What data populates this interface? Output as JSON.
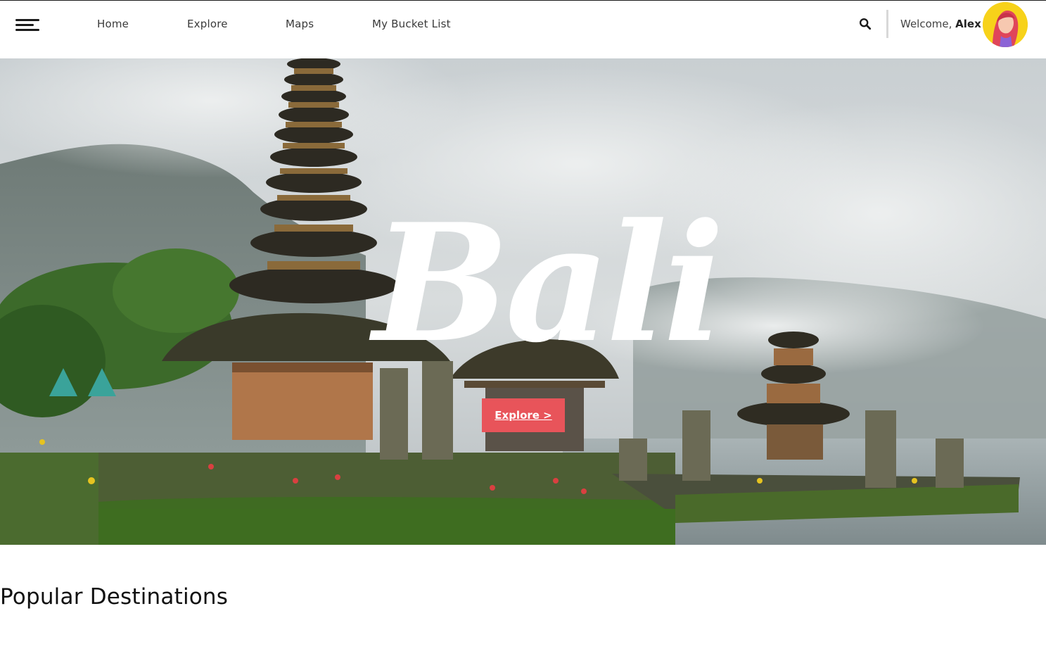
{
  "nav": {
    "links": [
      "Home",
      "Explore",
      "Maps",
      "My Bucket List"
    ],
    "welcome_prefix": "Welcome, ",
    "user_name": "Alex"
  },
  "hero": {
    "title": "Bali",
    "button_label": "Explore >"
  },
  "section": {
    "title": "Popular Destinations"
  },
  "icons": {
    "menu": "hamburger-menu-icon",
    "search": "search-icon",
    "avatar": "user-avatar"
  },
  "colors": {
    "accent": "#e8545a",
    "avatar_bg": "#f7d21a",
    "text": "#222222"
  }
}
